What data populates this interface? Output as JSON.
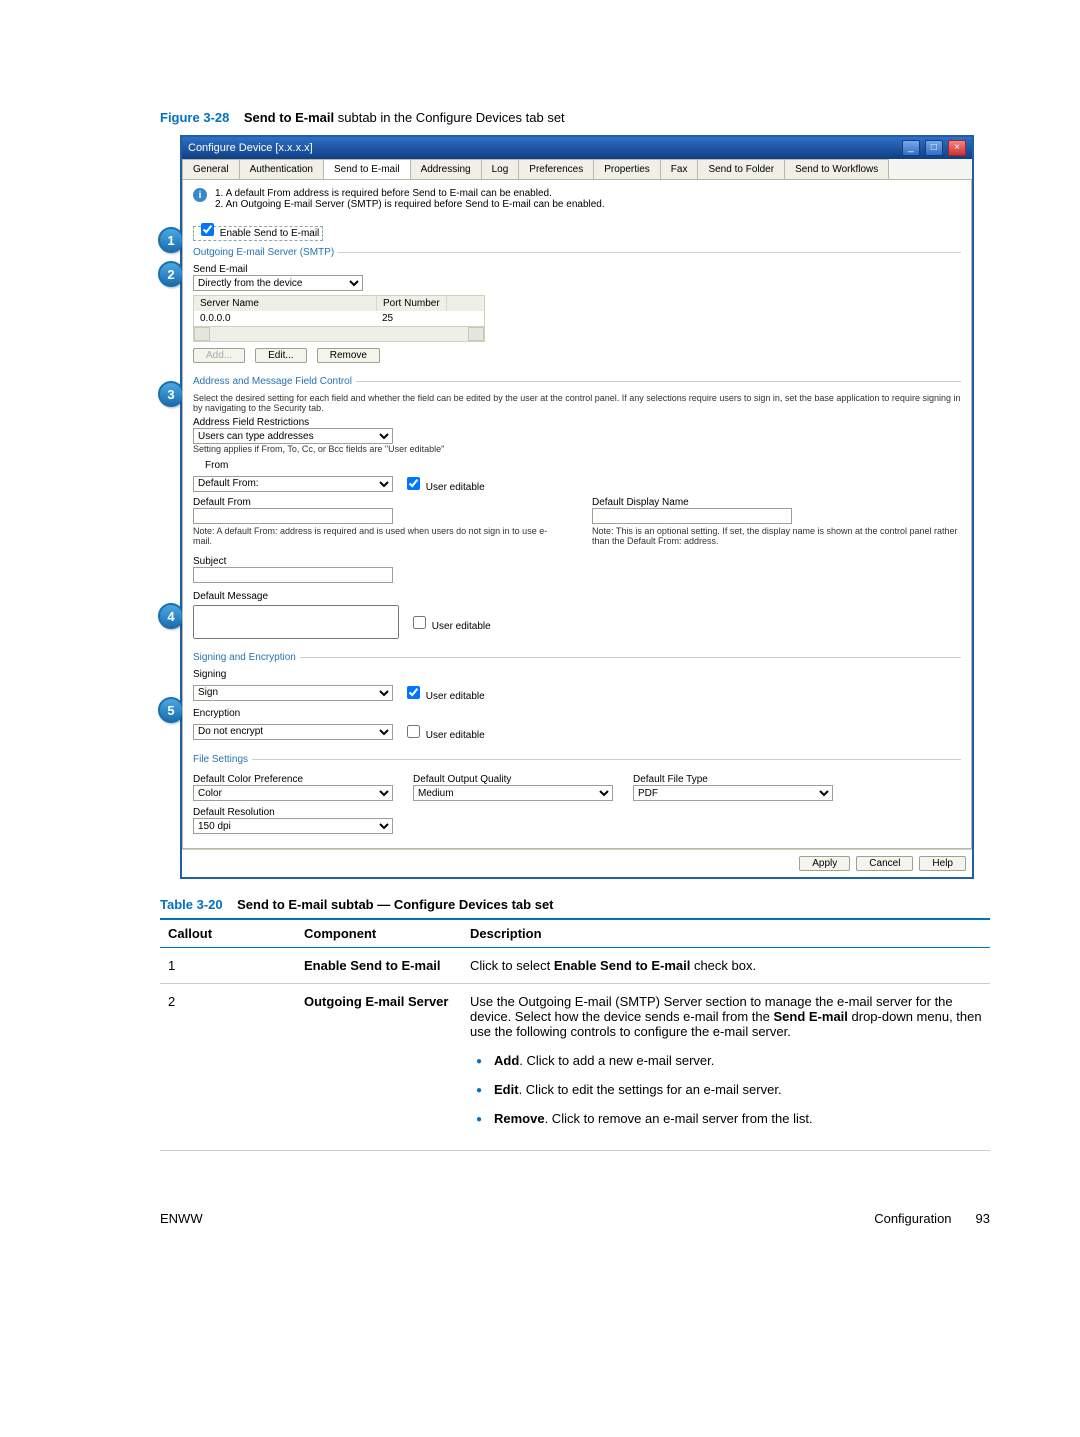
{
  "figure": {
    "label": "Figure 3-28",
    "title_bold": "Send to E-mail",
    "title_rest": " subtab in the Configure Devices tab set"
  },
  "window": {
    "title": "Configure Device [x.x.x.x]",
    "tabs": [
      "General",
      "Authentication",
      "Send to E-mail",
      "Addressing",
      "Log",
      "Preferences",
      "Properties",
      "Fax",
      "Send to Folder",
      "Send to Workflows"
    ],
    "active_tab_index": 2,
    "info_lines": [
      "1.  A default From address is required before Send to E-mail can be enabled.",
      "2.  An Outgoing E-mail Server (SMTP) is required before Send to E-mail can be enabled."
    ],
    "enable_label": "Enable Send to E-mail",
    "smtp": {
      "legend": "Outgoing E-mail Server (SMTP)",
      "send_label": "Send E-mail",
      "send_value": "Directly from the device",
      "col_server": "Server Name",
      "col_port": "Port Number",
      "server_name": "0.0.0.0",
      "port": "25",
      "btn_add": "Add...",
      "btn_edit": "Edit...",
      "btn_remove": "Remove"
    },
    "addr": {
      "legend": "Address and Message Field Control",
      "intro": "Select the desired setting for each field and whether the field can be edited by the user at the control panel. If any selections require users to sign in, set the base application to require signing in by navigating to the Security tab.",
      "restrictions_label": "Address Field Restrictions",
      "restrictions_value": "Users can type addresses",
      "restrictions_note": "Setting applies if From, To, Cc, or Bcc fields are \"User editable\"",
      "from_label": "From",
      "from_value": "Default From:",
      "user_editable": "User editable",
      "default_from_label": "Default From",
      "default_from_note": "Note: A default From: address is required and is used when users do not sign in to use e-mail.",
      "display_name_label": "Default Display Name",
      "display_name_note": "Note: This is an optional setting.  If set, the display name is shown at the control panel rather than the Default From: address.",
      "subject_label": "Subject",
      "message_label": "Default Message"
    },
    "signing": {
      "legend": "Signing and Encryption",
      "sign_label": "Signing",
      "sign_value": "Sign",
      "enc_label": "Encryption",
      "enc_value": "Do not encrypt",
      "user_editable": "User editable"
    },
    "files": {
      "legend": "File Settings",
      "color_label": "Default Color Preference",
      "color_value": "Color",
      "quality_label": "Default Output Quality",
      "quality_value": "Medium",
      "type_label": "Default File Type",
      "type_value": "PDF",
      "res_label": "Default Resolution",
      "res_value": "150 dpi"
    },
    "footer": {
      "apply": "Apply",
      "cancel": "Cancel",
      "help": "Help"
    }
  },
  "callouts": [
    "1",
    "2",
    "3",
    "4",
    "5"
  ],
  "table": {
    "label": "Table 3-20",
    "title": "Send to E-mail subtab — Configure Devices tab set",
    "headers": [
      "Callout",
      "Component",
      "Description"
    ],
    "rows": [
      {
        "callout": "1",
        "component": "Enable Send to E-mail",
        "desc_pre": "Click to select ",
        "desc_bold": "Enable Send to E-mail",
        "desc_post": " check box."
      },
      {
        "callout": "2",
        "component": "Outgoing E-mail Server",
        "desc_pre": "Use the Outgoing E-mail (SMTP) Server section to manage the e-mail server for the device. Select how the device sends e-mail from the ",
        "desc_bold": "Send E-mail",
        "desc_post": " drop-down menu, then use the following controls to configure the e-mail server.",
        "bullets": [
          {
            "b": "Add",
            "rest": ". Click to add a new e-mail server."
          },
          {
            "b": "Edit",
            "rest": ". Click to edit the settings for an e-mail server."
          },
          {
            "b": "Remove",
            "rest": ". Click to remove an e-mail server from the list."
          }
        ]
      }
    ]
  },
  "page_footer": {
    "left": "ENWW",
    "right_text": "Configuration",
    "page_no": "93"
  }
}
